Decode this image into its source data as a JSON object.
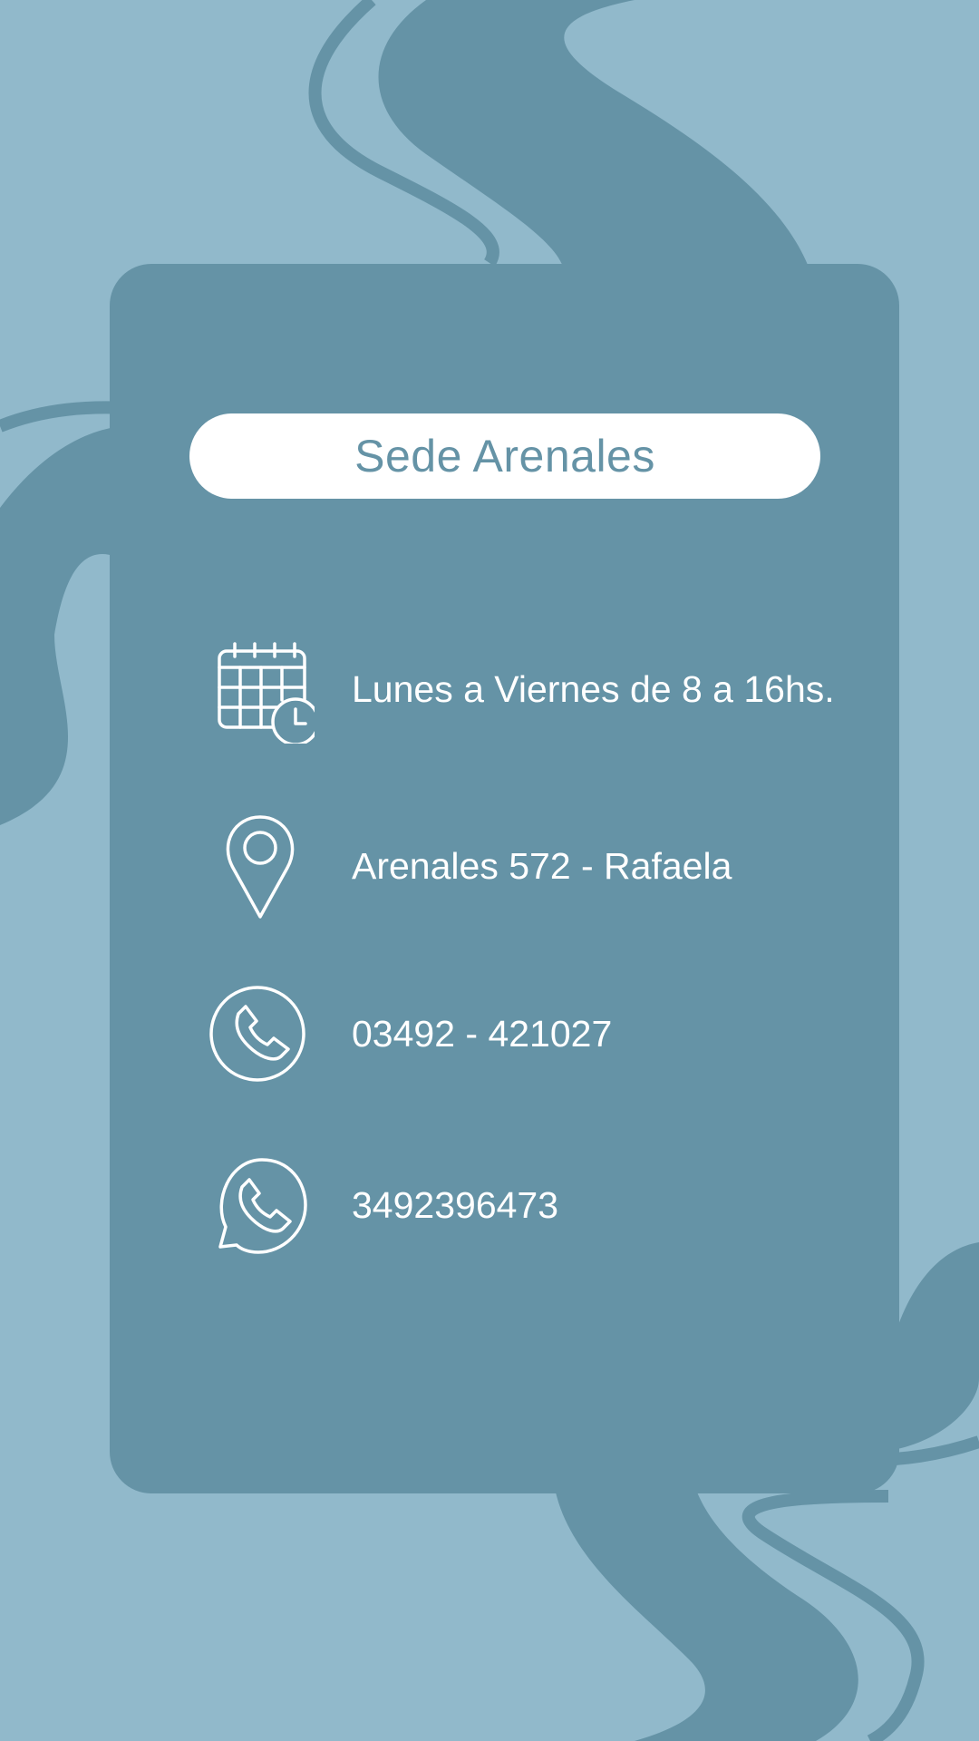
{
  "colors": {
    "background": "#91b9cb",
    "card": "#6593a6",
    "pill": "#ffffff",
    "title_text": "#6593a6",
    "info_text": "#ffffff"
  },
  "title": "Sede Arenales",
  "items": [
    {
      "icon": "calendar-clock-icon",
      "text": "Lunes a Viernes de 8 a 16hs."
    },
    {
      "icon": "location-pin-icon",
      "text": "Arenales 572 - Rafaela"
    },
    {
      "icon": "phone-icon",
      "text": "03492 - 421027"
    },
    {
      "icon": "whatsapp-icon",
      "text": "3492396473"
    }
  ]
}
